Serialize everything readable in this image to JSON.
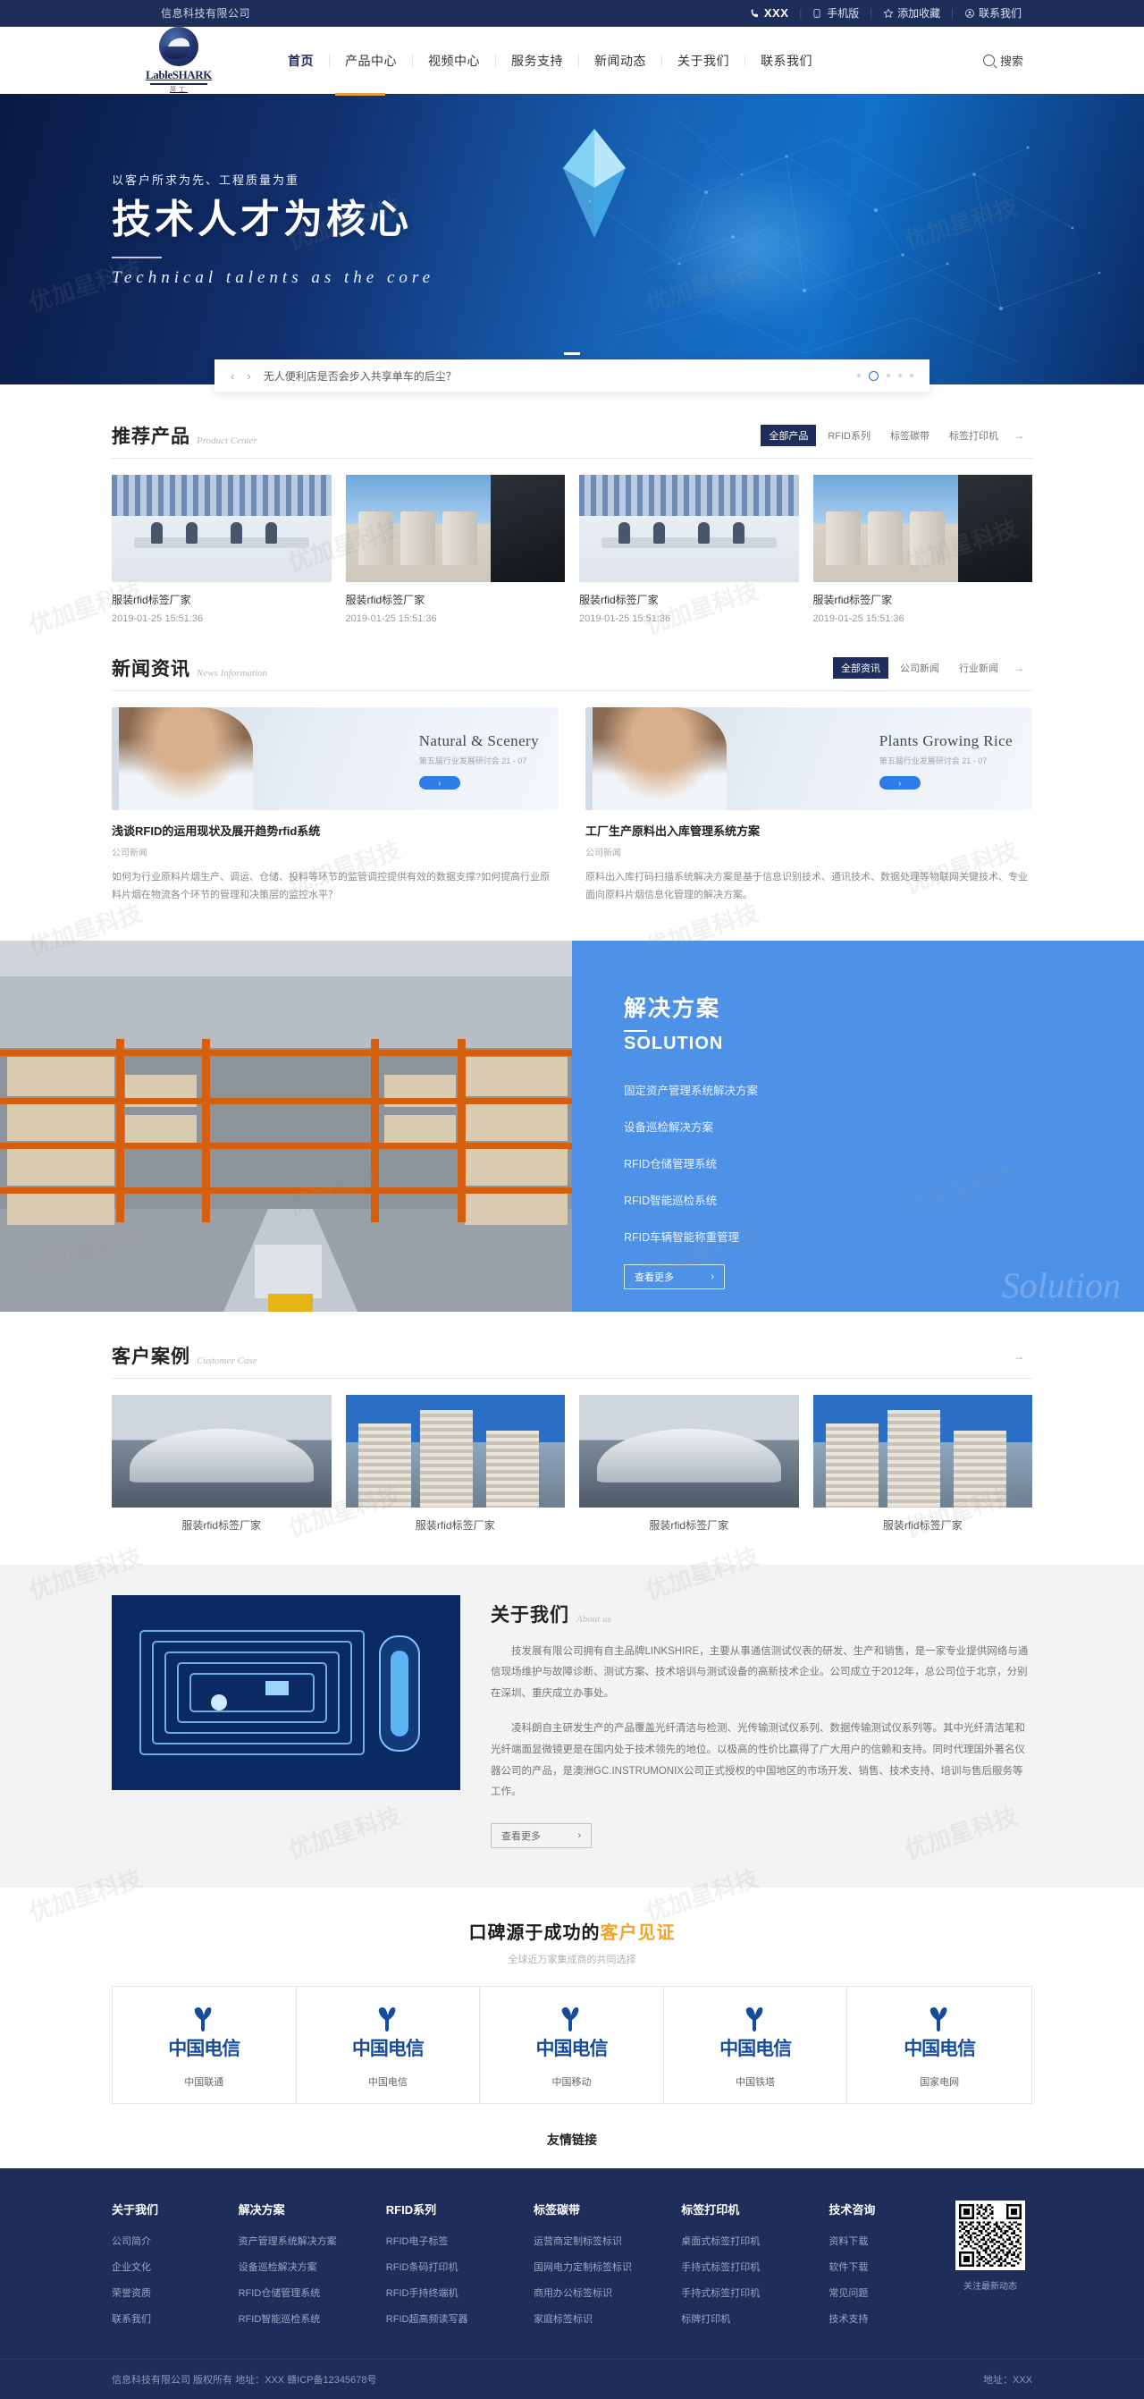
{
  "topbar": {
    "company": "信息科技有限公司",
    "phone_icon": "phone-icon",
    "phone": "XXX",
    "items": [
      {
        "icon": "mobile-icon",
        "label": "手机版"
      },
      {
        "icon": "star-icon",
        "label": "添加收藏"
      },
      {
        "icon": "contact-icon",
        "label": "联系我们"
      }
    ]
  },
  "header": {
    "logo_text": "LableSHARK",
    "logo_sub": "简工",
    "nav": [
      {
        "label": "首页",
        "active": true
      },
      {
        "label": "产品中心",
        "active": false
      },
      {
        "label": "视频中心",
        "active": false
      },
      {
        "label": "服务支持",
        "active": false
      },
      {
        "label": "新闻动态",
        "active": false
      },
      {
        "label": "关于我们",
        "active": false
      },
      {
        "label": "联系我们",
        "active": false
      }
    ],
    "search_label": "搜索",
    "search_icon": "search-icon"
  },
  "hero": {
    "subtitle": "以客户所求为先、工程质量为重",
    "title": "技术人才为核心",
    "english": "Technical talents as the core"
  },
  "notice": {
    "prev_icon": "chevron-left-icon",
    "next_icon": "chevron-right-icon",
    "text": "无人便利店是否会步入共享单车的后尘？"
  },
  "products": {
    "title_cn": "推荐产品",
    "title_en": "Product Center",
    "tabs": [
      {
        "label": "全部产品",
        "active": true
      },
      {
        "label": "RFID系列",
        "active": false
      },
      {
        "label": "标签碳带",
        "active": false
      },
      {
        "label": "标签打印机",
        "active": false
      }
    ],
    "more": "→",
    "items": [
      {
        "name": "服装rfid标签厂家",
        "date": "2019-01-25 15:51:36",
        "img": "office"
      },
      {
        "name": "服装rfid标签厂家",
        "date": "2019-01-25 15:51:36",
        "img": "silo"
      },
      {
        "name": "服装rfid标签厂家",
        "date": "2019-01-25 15:51:36",
        "img": "office"
      },
      {
        "name": "服装rfid标签厂家",
        "date": "2019-01-25 15:51:36",
        "img": "silo"
      }
    ]
  },
  "news": {
    "title_cn": "新闻资讯",
    "title_en": "News Information",
    "tabs": [
      {
        "label": "全部资讯",
        "active": true
      },
      {
        "label": "公司新闻",
        "active": false
      },
      {
        "label": "行业新闻",
        "active": false
      }
    ],
    "more": "→",
    "items": [
      {
        "banner_en": "Natural & Scenery",
        "banner_cn": "第五届行业发展研讨会 21 - 07",
        "banner_btn": "›",
        "title": "浅谈RFID的运用现状及展开趋势rfid系统",
        "category": "公司新闻",
        "desc": "如何为行业原料片烟生产、调运、仓储、投料等环节的监管调控提供有效的数据支撑?如何提高行业原料片烟在物流各个环节的管理和决策层的监控水平？"
      },
      {
        "banner_en": "Plants Growing Rice",
        "banner_cn": "第五届行业发展研讨会 21 - 07",
        "banner_btn": "›",
        "title": "工厂生产原料出入库管理系统方案",
        "category": "公司新闻",
        "desc": "原料出入库打码扫描系统解决方案是基于信息识别技术、通讯技术、数据处理等物联网关键技术、专业面向原料片烟信息化管理的解决方案。"
      }
    ]
  },
  "solution": {
    "title_cn": "解决方案",
    "title_en": "SOLUTION",
    "items": [
      "固定资产管理系统解决方案",
      "设备巡检解决方案",
      "RFID仓储管理系统",
      "RFID智能巡检系统",
      "RFID车辆智能称重管理"
    ],
    "more_label": "查看更多",
    "more_arrow": "›",
    "watermark": "Solution"
  },
  "cases": {
    "title_cn": "客户案例",
    "title_en": "Customer Case",
    "more": "→",
    "items": [
      {
        "name": "服装rfid标签厂家",
        "img": "opera"
      },
      {
        "name": "服装rfid标签厂家",
        "img": "hotel"
      },
      {
        "name": "服装rfid标签厂家",
        "img": "opera"
      },
      {
        "name": "服装rfid标签厂家",
        "img": "hotel"
      }
    ]
  },
  "about": {
    "title_cn": "关于我们",
    "title_en": "About us",
    "paragraphs": [
      "技发展有限公司拥有自主品牌LINKSHIRE，主要从事通信测试仪表的研发、生产和销售，是一家专业提供网络与通信现场维护与故障诊断、测试方案、技术培训与测试设备的高新技术企业。公司成立于2012年，总公司位于北京，分别在深圳、重庆成立办事处。",
      "凌科朗自主研发生产的产品覆盖光纤清洁与检测、光传输测试仪系列、数据传输测试仪系列等。其中光纤清洁笔和光纤端面显微镜更是在国内处于技术领先的地位。以极高的性价比赢得了广大用户的信赖和支持。同时代理国外著名仪器公司的产品，是澳洲GC.INSTRUMONIX公司正式授权的中国地区的市场开发、销售、技术支持、培训与售后服务等工作。"
    ],
    "more_label": "查看更多",
    "more_arrow": "›"
  },
  "testimonial": {
    "heading_plain": "口碑源于成功的",
    "heading_highlight": "客户见证",
    "sub": "全球近万家集成商的共同选择",
    "highlight_color": "#f2a425",
    "brands": [
      {
        "mark": "中国电信",
        "caption": "中国联通"
      },
      {
        "mark": "中国电信",
        "caption": "中国电信"
      },
      {
        "mark": "中国电信",
        "caption": "中国移动"
      },
      {
        "mark": "中国电信",
        "caption": "中国铁塔"
      },
      {
        "mark": "中国电信",
        "caption": "国家电网"
      }
    ],
    "friendly_links": "友情链接"
  },
  "footer": {
    "columns": [
      {
        "title": "关于我们",
        "links": [
          "公司简介",
          "企业文化",
          "荣誉资质",
          "联系我们"
        ]
      },
      {
        "title": "解决方案",
        "links": [
          "资产管理系统解决方案",
          "设备巡检解决方案",
          "RFID仓储管理系统",
          "RFID智能巡检系统"
        ]
      },
      {
        "title": "RFID系列",
        "links": [
          "RFID电子标签",
          "RFID条码打印机",
          "RFID手持终端机",
          "RFID超高频读写器"
        ]
      },
      {
        "title": "标签碳带",
        "links": [
          "运营商定制标签标识",
          "国网电力定制标签标识",
          "商用办公标签标识",
          "家庭标签标识"
        ]
      },
      {
        "title": "标签打印机",
        "links": [
          "桌面式标签打印机",
          "手持式标签打印机",
          "手持式标签打印机",
          "标牌打印机"
        ]
      },
      {
        "title": "技术咨询",
        "links": [
          "资料下载",
          "软件下载",
          "常见问题",
          "技术支持"
        ]
      }
    ],
    "qr_caption": "关注最新动态",
    "copyright": "信息科技有限公司  版权所有  地址：XXX  赣ICP备12345678号",
    "address_right": "地址：XXX"
  },
  "watermark_text": "优加星科技"
}
